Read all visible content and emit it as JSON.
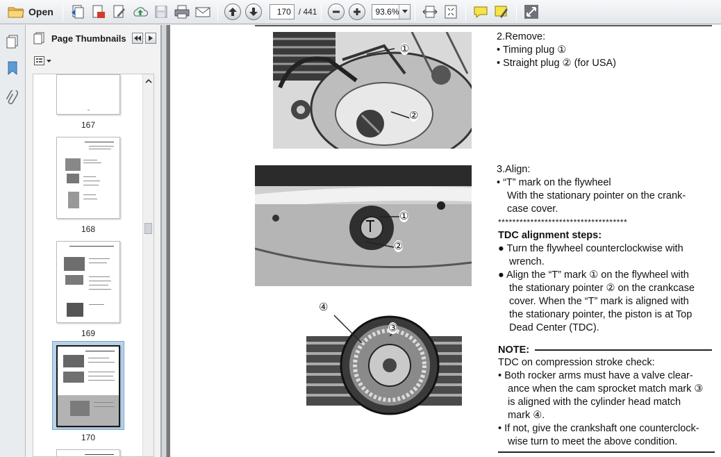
{
  "toolbar": {
    "open_label": "Open",
    "page_current": "170",
    "page_total": "/ 441",
    "zoom": "93.6%"
  },
  "thumbnails": {
    "title": "Page Thumbnails",
    "pages": [
      {
        "label": "167"
      },
      {
        "label": "168"
      },
      {
        "label": "169"
      },
      {
        "label": "170",
        "selected": true
      }
    ]
  },
  "document": {
    "step2": {
      "heading": "2.Remove:",
      "items": [
        "• Timing plug ①",
        "• Straight plug ② (for USA)"
      ]
    },
    "step3": {
      "heading": "3.Align:",
      "item": "• “T” mark on the flywheel",
      "sub1": "With the stationary pointer on the crank-",
      "sub2": "case cover."
    },
    "stars": "************************************",
    "tdc": {
      "heading": "TDC alignment steps:",
      "b1_l1": "● Turn the flywheel counterclockwise with",
      "b1_l2": "wrench.",
      "b2_l1": "● Align the “T” mark ① on the flywheel with",
      "b2_l2": "the stationary pointer ② on the crankcase",
      "b2_l3": "cover. When the “T” mark is aligned with",
      "b2_l4": "the stationary pointer, the piston is at Top",
      "b2_l5": "Dead Center (TDC)."
    },
    "note": {
      "heading": "NOTE:",
      "intro": "TDC on compression stroke check:",
      "b1_l1": "• Both rocker arms must have a valve clear-",
      "b1_l2": "ance when the cam sprocket match mark ③",
      "b1_l3": "is aligned with the cylinder head match",
      "b1_l4": "mark ④.",
      "b2_l1": "• If not, give the crankshaft one counterclock-",
      "b2_l2": "wise turn to meet the above condition."
    },
    "callouts": {
      "p1a": "①",
      "p1b": "②",
      "p2a": "①",
      "p2b": "②",
      "p3a": "④",
      "p3b": "③"
    }
  }
}
